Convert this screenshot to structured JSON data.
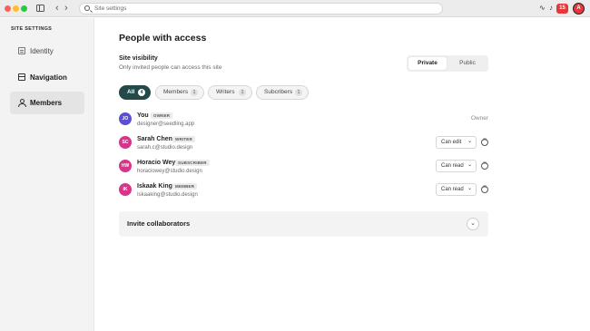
{
  "address_bar": {
    "placeholder": "Site settings"
  },
  "notifications": {
    "count": "15"
  },
  "profile": {
    "initial": "A"
  },
  "sidebar": {
    "heading": "SITE SETTINGS",
    "items": [
      {
        "label": "Identity",
        "icon": "identity-icon"
      },
      {
        "label": "Navigation",
        "icon": "navigation-icon"
      },
      {
        "label": "Members",
        "icon": "members-icon"
      }
    ]
  },
  "main": {
    "title": "People with access",
    "visibility": {
      "label": "Site visibility",
      "description": "Only invited people can access this site",
      "options": [
        "Private",
        "Public"
      ],
      "selected": "Private"
    },
    "filters": [
      {
        "label": "All",
        "count": "4"
      },
      {
        "label": "Members",
        "count": "1"
      },
      {
        "label": "Writers",
        "count": "1"
      },
      {
        "label": "Subcribers",
        "count": "1"
      }
    ],
    "members": [
      {
        "initials": "JO",
        "name": "You",
        "role": "OWNER",
        "email": "designer@seedling.app",
        "access": "Owner",
        "color": "#5b4fd6"
      },
      {
        "initials": "SC",
        "name": "Sarah Chen",
        "role": "WRITER",
        "email": "sarah.c@studio.design",
        "access": "Can edit",
        "color": "#d6358a"
      },
      {
        "initials": "HW",
        "name": "Horacio Wey",
        "role": "SUBSCRIBER",
        "email": "horaciowey@studio.design",
        "access": "Can read",
        "color": "#d6358a"
      },
      {
        "initials": "IK",
        "name": "Iskaak King",
        "role": "MEMBER",
        "email": "Iskaaking@studio.design",
        "access": "Can read",
        "color": "#d6358a"
      }
    ],
    "invite": {
      "title": "Invite collaborators"
    }
  }
}
